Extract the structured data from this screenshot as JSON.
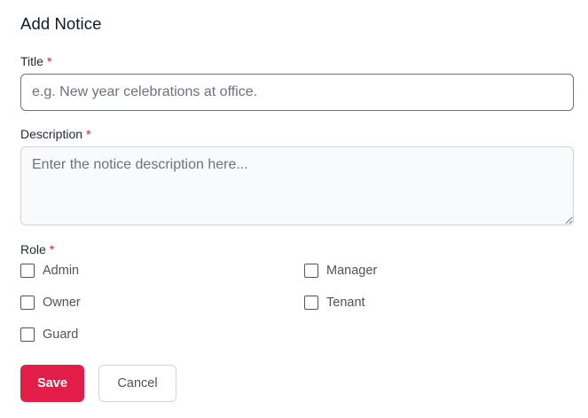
{
  "form": {
    "heading": "Add Notice",
    "required_marker": "*",
    "title_field": {
      "label": "Title",
      "placeholder": "e.g. New year celebrations at office.",
      "value": ""
    },
    "description_field": {
      "label": "Description",
      "placeholder": "Enter the notice description here...",
      "value": ""
    },
    "role_field": {
      "label": "Role",
      "options": [
        {
          "label": "Admin",
          "checked": false
        },
        {
          "label": "Manager",
          "checked": false
        },
        {
          "label": "Owner",
          "checked": false
        },
        {
          "label": "Tenant",
          "checked": false
        },
        {
          "label": "Guard",
          "checked": false
        }
      ]
    },
    "buttons": {
      "save_label": "Save",
      "cancel_label": "Cancel"
    }
  },
  "colors": {
    "accent": "#e11d48",
    "border": "#d1d5db",
    "focus_border": "#6b7280",
    "text": "#1f2937",
    "muted_text": "#4b5563"
  }
}
